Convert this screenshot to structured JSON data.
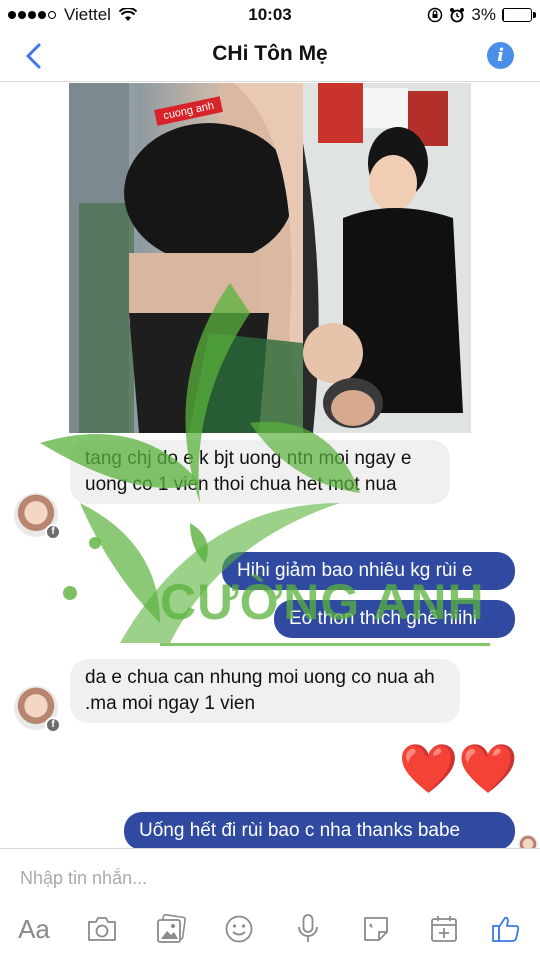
{
  "status_bar": {
    "carrier": "Viettel",
    "time": "10:03",
    "battery_percent": "3%",
    "battery_level": 0.03,
    "signal_bars_filled": 4,
    "signal_bars_total": 5
  },
  "nav": {
    "title": "CHi Tôn Mẹ",
    "back_icon": "chevron-left-icon",
    "info_icon": "info-icon",
    "accent_color": "#3b7be8"
  },
  "photo": {
    "watermark_badge": "cuong anh"
  },
  "messages": [
    {
      "sender": "contact",
      "text": "tang chj do e k bjt uong ntn moi ngay e uong co 1 vien thoi chua het mot nua"
    },
    {
      "sender": "me",
      "text": "Hihi giảm bao nhiêu kg rùi e"
    },
    {
      "sender": "me",
      "text": "Eo thon thích ghê hiihi"
    },
    {
      "sender": "contact",
      "text": "da e chua can nhung moi uong co nua ah .ma moi ngay 1 vien"
    },
    {
      "sender": "me",
      "text": "❤️❤️"
    },
    {
      "sender": "me",
      "text": "Uống hết đi rùi bao c nha thanks babe"
    }
  ],
  "watermark": {
    "text": "CƯỜNG ANH",
    "color": "#5ab23c"
  },
  "composer": {
    "placeholder": "Nhập tin nhắn...",
    "aa_label": "Aa",
    "tools": [
      "aa-icon",
      "camera-icon",
      "gallery-icon",
      "emoji-icon",
      "microphone-icon",
      "sticker-icon",
      "calendar-plus-icon",
      "like-icon"
    ]
  },
  "colors": {
    "outgoing_bubble": "#2f4aa0",
    "incoming_bubble": "#f0f0f0",
    "accent": "#3b7be8",
    "like": "#3b7be8"
  }
}
